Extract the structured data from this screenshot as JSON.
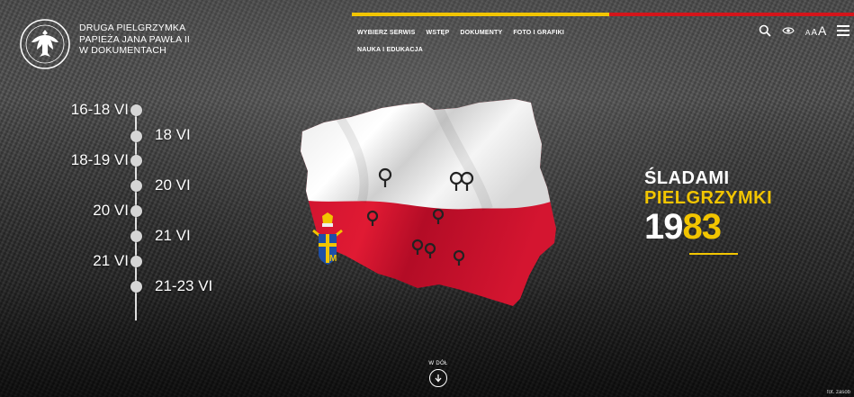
{
  "header": {
    "logo_lines": [
      "DRUGA PIELGRZYMKA",
      "PAPIEŻA JANA PAWŁA II",
      "W DOKUMENTACH"
    ],
    "nav_row1": [
      "WYBIERZ SERWIS",
      "WSTĘP",
      "DOKUMENTY",
      "FOTO I GRAFIKI"
    ],
    "nav_row2": [
      "NAUKA I EDUKACJA"
    ],
    "font_size_labels": [
      "A",
      "A",
      "A"
    ],
    "colors": {
      "accent_yellow": "#f2c500",
      "accent_red": "#d4151b"
    }
  },
  "timeline": {
    "left_labels": [
      "16-18 VI",
      "18-19 VI",
      "20 VI",
      "21 VI"
    ],
    "right_labels": [
      "18 VI",
      "20 VI",
      "21 VI",
      "21-23 VI"
    ]
  },
  "title": {
    "line1": "ŚLADAMI",
    "line2": "PIELGRZYMKI",
    "year_white": "19",
    "year_yellow": "83"
  },
  "scroll": {
    "label": "W DÓŁ"
  },
  "credit": "fot. zasób"
}
